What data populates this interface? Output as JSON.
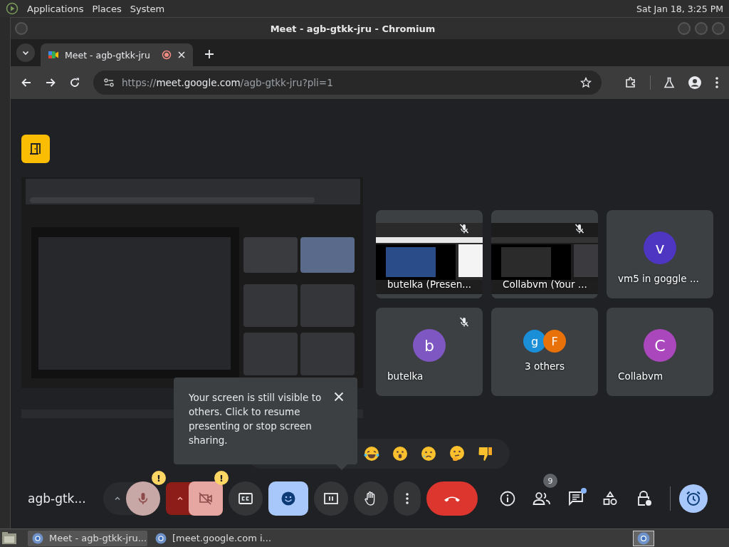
{
  "top_panel": {
    "menus": [
      "Applications",
      "Places",
      "System"
    ],
    "clock": "Sat Jan 18, 3:25 PM"
  },
  "window": {
    "title": "Meet - agb-gtkk-jru - Chromium"
  },
  "tabs": [
    {
      "title": "Meet - agb-gtkk-jru",
      "selected": true,
      "recording": true
    }
  ],
  "address_bar": {
    "scheme": "https://",
    "host": "meet.google.com",
    "path": "/agb-gtkk-jru?pli=1"
  },
  "tiles": [
    {
      "kind": "screen",
      "name": "butelka (Presen...",
      "muted": true
    },
    {
      "kind": "screen",
      "name": "Collabvm (Your ...",
      "muted": true
    },
    {
      "kind": "avatar",
      "name": "vm5 in goggle ...",
      "letter": "v",
      "color": "#4e35c2",
      "muted": false
    },
    {
      "kind": "avatar",
      "name": "butelka",
      "letter": "b",
      "color": "#7e57c2",
      "muted": true
    },
    {
      "kind": "group",
      "name": "3 others",
      "avatars": [
        {
          "letter": "g",
          "color": "#1a8fd8"
        },
        {
          "letter": "F",
          "color": "#e8710a"
        }
      ],
      "muted": false
    },
    {
      "kind": "avatar",
      "name": "Collabvm",
      "letter": "C",
      "color": "#ab47bc",
      "muted": false
    }
  ],
  "tooltip": {
    "text": "Your screen is still visible to others. Click to resume presenting or stop screen sharing."
  },
  "meeting_name": "agb-gtk...",
  "controls": [
    {
      "kind": "mic",
      "badge": "!"
    },
    {
      "kind": "camera",
      "badge": "!"
    },
    {
      "kind": "captions",
      "selected": false
    },
    {
      "kind": "reactions",
      "selected": true
    },
    {
      "kind": "present",
      "selected": false
    },
    {
      "kind": "hand",
      "selected": false
    },
    {
      "kind": "more"
    },
    {
      "kind": "leave"
    }
  ],
  "side_controls": [
    {
      "kind": "info"
    },
    {
      "kind": "people",
      "badge": "9"
    },
    {
      "kind": "chat",
      "unread": true
    },
    {
      "kind": "activities"
    },
    {
      "kind": "host"
    }
  ],
  "taskbar": [
    {
      "title": "Meet - agb-gtkk-jru...",
      "selected": true
    },
    {
      "title": "[meet.google.com i...",
      "selected": false
    }
  ]
}
